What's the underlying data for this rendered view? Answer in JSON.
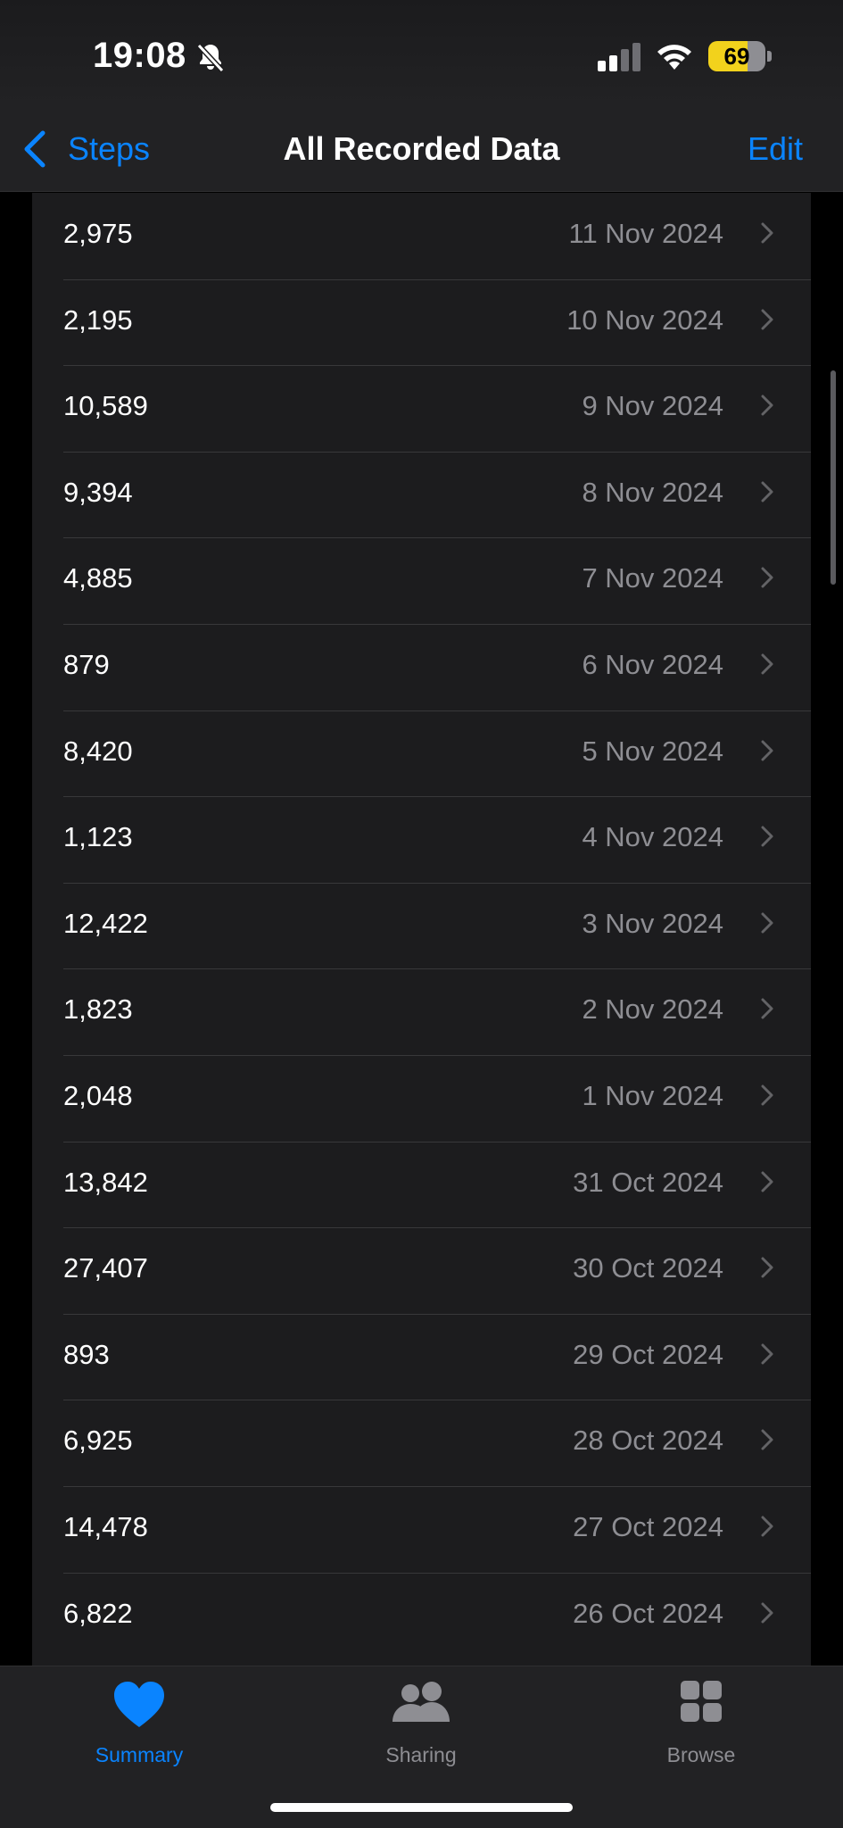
{
  "status_bar": {
    "time": "19:08",
    "battery_level": "69",
    "silent_mode": true,
    "battery_color": "#f2d21c"
  },
  "nav": {
    "back_label": "Steps",
    "title": "All Recorded Data",
    "edit_label": "Edit",
    "accent_color": "#0a84ff"
  },
  "records": [
    {
      "value": "2,975",
      "date": "11 Nov 2024"
    },
    {
      "value": "2,195",
      "date": "10 Nov 2024"
    },
    {
      "value": "10,589",
      "date": "9 Nov 2024"
    },
    {
      "value": "9,394",
      "date": "8 Nov 2024"
    },
    {
      "value": "4,885",
      "date": "7 Nov 2024"
    },
    {
      "value": "879",
      "date": "6 Nov 2024"
    },
    {
      "value": "8,420",
      "date": "5 Nov 2024"
    },
    {
      "value": "1,123",
      "date": "4 Nov 2024"
    },
    {
      "value": "12,422",
      "date": "3 Nov 2024"
    },
    {
      "value": "1,823",
      "date": "2 Nov 2024"
    },
    {
      "value": "2,048",
      "date": "1 Nov 2024"
    },
    {
      "value": "13,842",
      "date": "31 Oct 2024"
    },
    {
      "value": "27,407",
      "date": "30 Oct 2024"
    },
    {
      "value": "893",
      "date": "29 Oct 2024"
    },
    {
      "value": "6,925",
      "date": "28 Oct 2024"
    },
    {
      "value": "14,478",
      "date": "27 Oct 2024"
    },
    {
      "value": "6,822",
      "date": "26 Oct 2024"
    }
  ],
  "tabs": [
    {
      "label": "Summary",
      "icon": "heart-icon",
      "active": true
    },
    {
      "label": "Sharing",
      "icon": "people-icon",
      "active": false
    },
    {
      "label": "Browse",
      "icon": "grid-icon",
      "active": false
    }
  ]
}
